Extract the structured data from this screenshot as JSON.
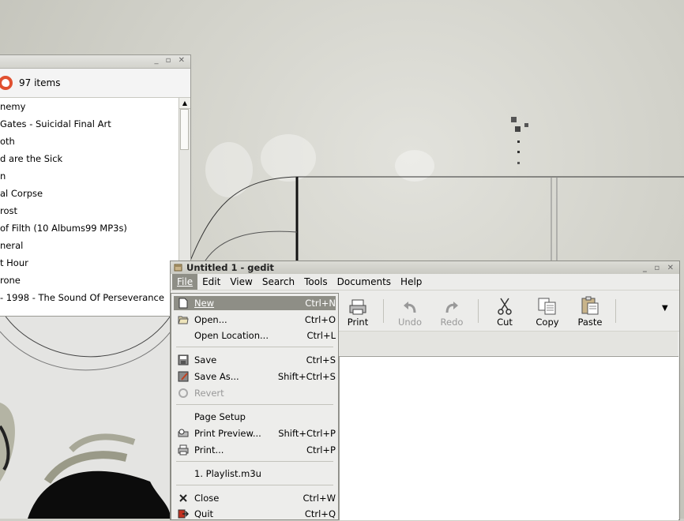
{
  "listwin": {
    "count": "97 items",
    "rows": [
      "nemy",
      "Gates - Suicidal Final Art",
      "oth",
      "d are the Sick",
      "n",
      "al Corpse",
      "rost",
      "of Filth (10 Albums99 MP3s)",
      "neral",
      "t Hour",
      "rone",
      "- 1998 - The Sound Of Perseverance"
    ]
  },
  "gedit": {
    "title": "Untitled 1 - gedit",
    "menus": [
      "File",
      "Edit",
      "View",
      "Search",
      "Tools",
      "Documents",
      "Help"
    ],
    "toolbar": {
      "print": "Print",
      "undo": "Undo",
      "redo": "Redo",
      "cut": "Cut",
      "copy": "Copy",
      "paste": "Paste"
    }
  },
  "filemenu": {
    "new": {
      "label": "New",
      "accel": "Ctrl+N"
    },
    "open": {
      "label": "Open...",
      "accel": "Ctrl+O"
    },
    "open_location": {
      "label": "Open Location...",
      "accel": "Ctrl+L"
    },
    "save": {
      "label": "Save",
      "accel": "Ctrl+S"
    },
    "save_as": {
      "label": "Save As...",
      "accel": "Shift+Ctrl+S"
    },
    "revert": {
      "label": "Revert"
    },
    "page_setup": {
      "label": "Page Setup"
    },
    "print_preview": {
      "label": "Print Preview...",
      "accel": "Shift+Ctrl+P"
    },
    "print": {
      "label": "Print...",
      "accel": "Ctrl+P"
    },
    "recent1": {
      "label": "1. Playlist.m3u"
    },
    "close": {
      "label": "Close",
      "accel": "Ctrl+W"
    },
    "quit": {
      "label": "Quit",
      "accel": "Ctrl+Q"
    }
  },
  "colors": {
    "highlight": "#8e8e86",
    "menu_bg": "#ededeb"
  }
}
